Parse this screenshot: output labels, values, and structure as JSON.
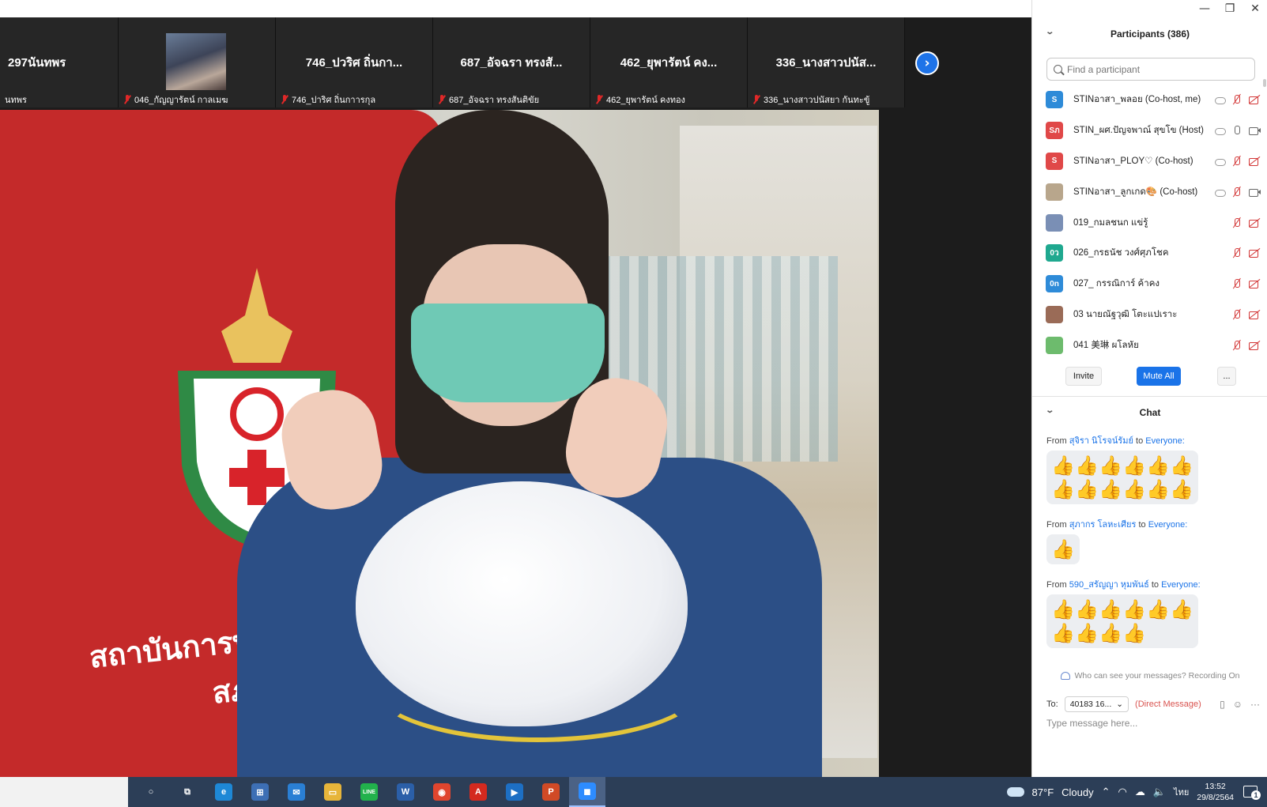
{
  "thumbnails": [
    {
      "name": "297นันทพร",
      "label": "นทพร",
      "muted": false
    },
    {
      "name": "",
      "label": "046_กัญญารัตน์ กาลเมฆ",
      "muted": true,
      "has_photo": true
    },
    {
      "name": "746_ปวริศ ถิ่นกา...",
      "label": "746_ปาริศ ถิ่นกาารกุล",
      "muted": true
    },
    {
      "name": "687_อัจฉรา ทรงสั...",
      "label": "687_อัจฉรา ทรงสันติขัย",
      "muted": true
    },
    {
      "name": "462_ยุพารัตน์ คง...",
      "label": "462_ยุพารัตน์ คงทอง",
      "muted": true
    },
    {
      "name": "336_นางสาวปนัส...",
      "label": "336_นางสาวปนัสยา กันทะขู้",
      "muted": true
    }
  ],
  "video": {
    "shirt_text": "สถาบันการพย",
    "shirt_text2": "สภ"
  },
  "window_controls": {
    "minimize": "—",
    "restore": "❐",
    "close": "✕"
  },
  "participants": {
    "title": "Participants (386)",
    "search_placeholder": "Find a participant",
    "items": [
      {
        "avatar": "S",
        "color": "#2e8bd8",
        "name": "STINอาสา_พลอย (Co-host, me)",
        "cloud": true,
        "mic": "off",
        "cam": "off"
      },
      {
        "avatar": "Sภ",
        "color": "#e04848",
        "name": "STIN_ผศ.ปัญจพาณ์ สุขโข (Host)",
        "cloud": true,
        "mic": "on",
        "cam": "on"
      },
      {
        "avatar": "S",
        "color": "#e04848",
        "name": "STINอาสา_PLOY♡ (Co-host)",
        "cloud": true,
        "mic": "off",
        "cam": "off"
      },
      {
        "avatar": "",
        "color": "#b8a68c",
        "name": "STINอาสา_ลูกเกด🎨 (Co-host)",
        "cloud": true,
        "mic": "off",
        "cam": "on"
      },
      {
        "avatar": "",
        "color": "#7a8fb5",
        "name": "019_กมลชนก แข่รู้",
        "cloud": false,
        "mic": "off",
        "cam": "off"
      },
      {
        "avatar": "0ว",
        "color": "#1fa88f",
        "name": "026_กรธนัช วงศ์ศุภโชค",
        "cloud": false,
        "mic": "off",
        "cam": "off"
      },
      {
        "avatar": "0n",
        "color": "#2e8bd8",
        "name": "027_ กรรณิการ์ ค้าคง",
        "cloud": false,
        "mic": "off",
        "cam": "off"
      },
      {
        "avatar": "",
        "color": "#9a6b57",
        "name": "03 นายณัฐวุฒิ โตะแปเราะ",
        "cloud": false,
        "mic": "off",
        "cam": "off"
      },
      {
        "avatar": "",
        "color": "#6dbb6d",
        "name": "041 美琳 ผโลหัย",
        "cloud": false,
        "mic": "off",
        "cam": "off"
      }
    ],
    "invite_label": "Invite",
    "mute_all_label": "Mute All",
    "more_label": "..."
  },
  "chat": {
    "title": "Chat",
    "messages": [
      {
        "from_word": "From",
        "sender": "สุจิรา นิโรจน์รัมย์",
        "to_word": "to",
        "recipient": "Everyone:",
        "emoji": "👍",
        "count": 12
      },
      {
        "from_word": "From",
        "sender": "สุภากร โลหะเศียร",
        "to_word": "to",
        "recipient": "Everyone:",
        "emoji": "👍",
        "count": 1
      },
      {
        "from_word": "From",
        "sender": "590_สรัญญา หุมพันธ์",
        "to_word": "to",
        "recipient": "Everyone:",
        "emoji": "👍",
        "count": 10
      }
    ],
    "privacy_note": "Who can see your messages? Recording On",
    "to_label": "To:",
    "to_value": "40183 16...",
    "direct_message": "(Direct Message)",
    "input_placeholder": "Type message here..."
  },
  "taskbar": {
    "apps": [
      {
        "name": "cortana",
        "glyph": "○",
        "color": "transparent"
      },
      {
        "name": "task-view",
        "glyph": "⧉",
        "color": "transparent"
      },
      {
        "name": "edge",
        "glyph": "e",
        "color": "#1e88d6"
      },
      {
        "name": "store",
        "glyph": "⊞",
        "color": "#3d6fb5"
      },
      {
        "name": "mail",
        "glyph": "✉",
        "color": "#2a7fd4"
      },
      {
        "name": "file-explorer",
        "glyph": "▭",
        "color": "#e7b53a"
      },
      {
        "name": "line",
        "glyph": "LINE",
        "color": "#22b24c"
      },
      {
        "name": "word",
        "glyph": "W",
        "color": "#2b5fa8"
      },
      {
        "name": "chrome",
        "glyph": "◉",
        "color": "#e0452e"
      },
      {
        "name": "acrobat",
        "glyph": "A",
        "color": "#d42a1f"
      },
      {
        "name": "media-player",
        "glyph": "▶",
        "color": "#1d6fc4"
      },
      {
        "name": "powerpoint",
        "glyph": "P",
        "color": "#d04a26"
      },
      {
        "name": "zoom",
        "glyph": "◼",
        "color": "#2d8cff"
      }
    ],
    "weather_temp": "87°F",
    "weather_text": "Cloudy",
    "caret": "⌃",
    "lang": "ไทย",
    "time": "13:52",
    "date": "29/8/2564",
    "notif_count": "1"
  }
}
